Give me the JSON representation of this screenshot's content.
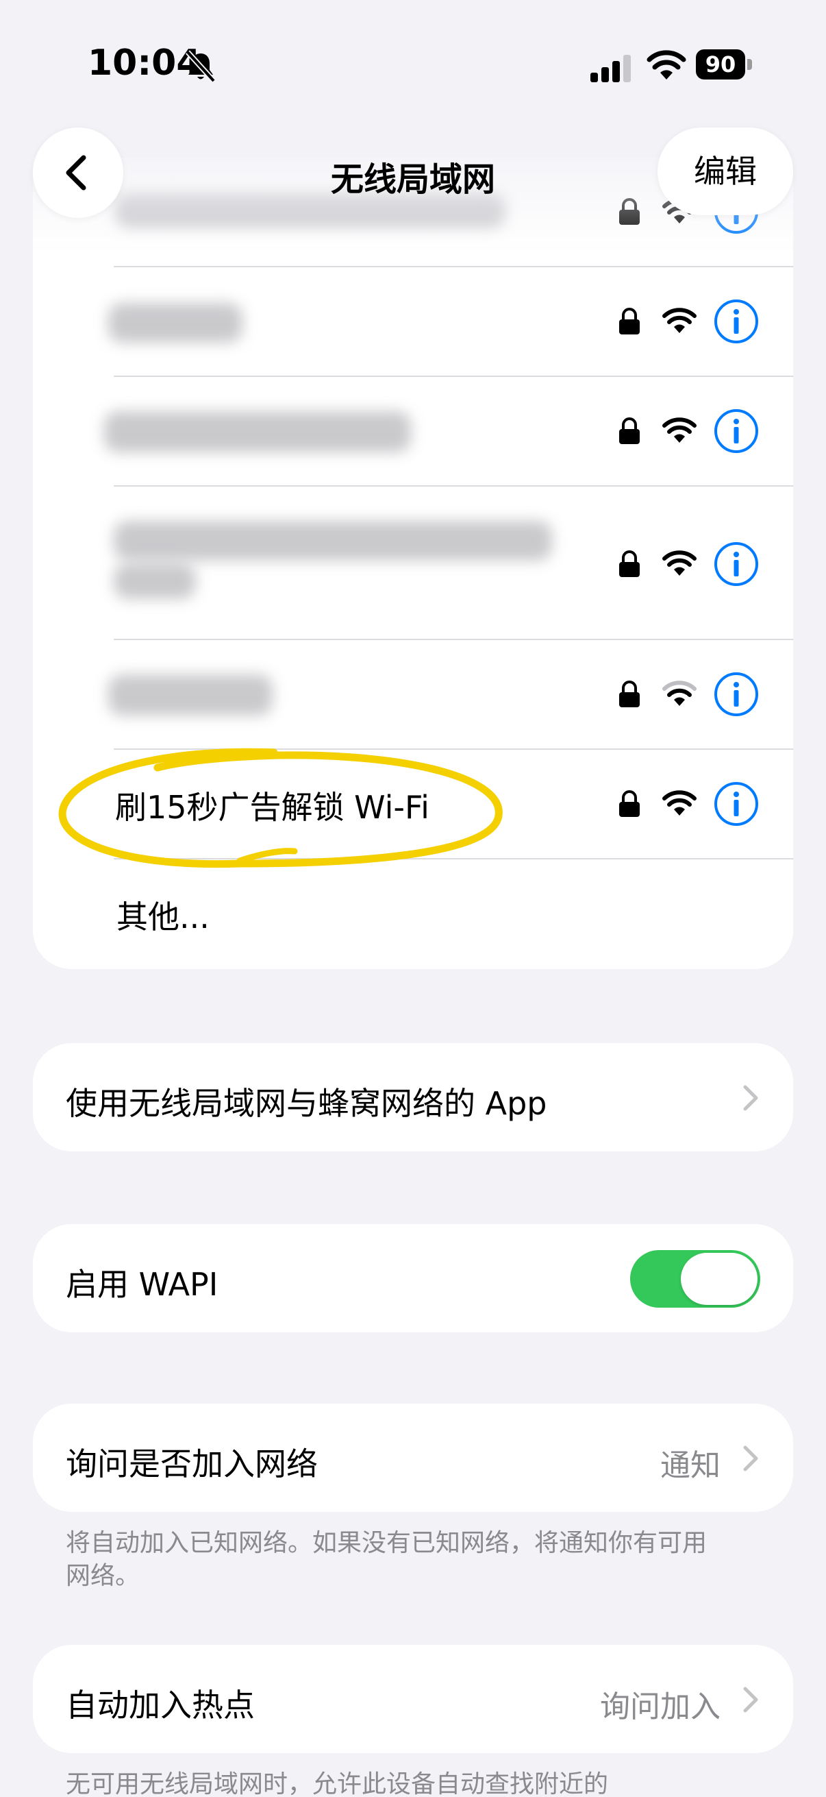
{
  "status_bar": {
    "time": "10:04",
    "battery": "90",
    "icons": [
      "bell-slash-icon",
      "cellular-signal-icon",
      "wifi-icon",
      "battery-icon"
    ]
  },
  "nav": {
    "title": "无线局域网",
    "edit_label": "编辑",
    "back_icon": "chevron-left-icon"
  },
  "networks": {
    "highlighted_name": "刷15秒广告解锁 Wi-Fi",
    "other_label": "其他...",
    "row_icons": [
      "lock-icon",
      "wifi-icon",
      "info-icon"
    ]
  },
  "apps_row": {
    "label": "使用无线局域网与蜂窝网络的 App"
  },
  "wapi_row": {
    "label": "启用 WAPI",
    "enabled": true
  },
  "ask_join": {
    "label": "询问是否加入网络",
    "value": "通知",
    "footnote": "将自动加入已知网络。如果没有已知网络，将通知你有可用网络。"
  },
  "hotspot": {
    "label": "自动加入热点",
    "value": "询问加入",
    "footnote": "无可用无线局域网时，允许此设备自动查找附近的"
  },
  "colors": {
    "accent": "#007aff",
    "toggle_on": "#34c759",
    "highlight": "#f5d000",
    "background": "#f2f2f7"
  }
}
